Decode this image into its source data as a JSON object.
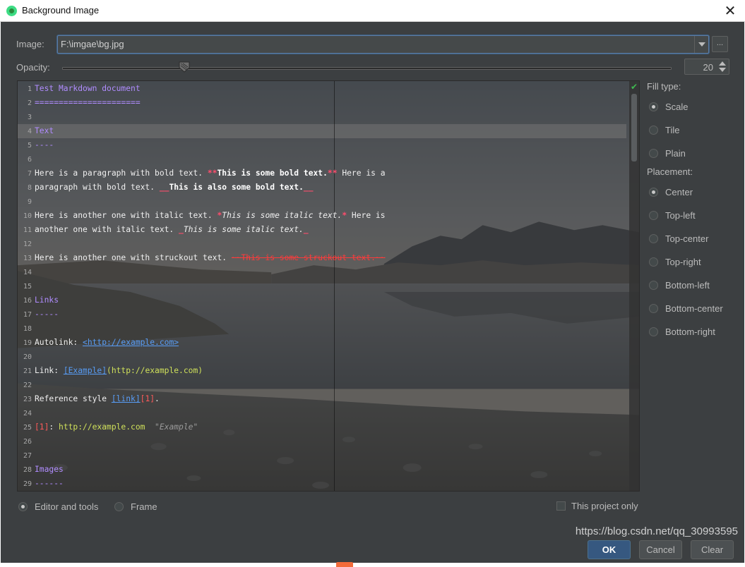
{
  "window": {
    "title": "Background Image",
    "close_glyph": "✕"
  },
  "image": {
    "label": "Image:",
    "value": "F:\\imgae\\bg.jpg",
    "browse_label": "..."
  },
  "opacity": {
    "label": "Opacity:",
    "value": "20",
    "level_percent": 20
  },
  "editor_lines": [
    {
      "n": "1",
      "tokens": [
        {
          "t": "Test Markdown document",
          "c": "t-head"
        }
      ]
    },
    {
      "n": "2",
      "tokens": [
        {
          "t": "======================",
          "c": "t-head"
        }
      ]
    },
    {
      "n": "3",
      "tokens": []
    },
    {
      "n": "4",
      "tokens": [
        {
          "t": "Text",
          "c": "t-head"
        }
      ]
    },
    {
      "n": "5",
      "tokens": [
        {
          "t": "----",
          "c": "t-head"
        }
      ]
    },
    {
      "n": "6",
      "tokens": []
    },
    {
      "n": "7",
      "tokens": [
        {
          "t": "Here is a paragraph with bold text. ",
          "c": "t-plain"
        },
        {
          "t": "**",
          "c": "t-mark"
        },
        {
          "t": "This is some bold text.",
          "c": "t-bold"
        },
        {
          "t": "**",
          "c": "t-mark"
        },
        {
          "t": " Here is a",
          "c": "t-plain"
        }
      ]
    },
    {
      "n": "8",
      "tokens": [
        {
          "t": "paragraph with bold text. ",
          "c": "t-plain"
        },
        {
          "t": "__",
          "c": "t-mark"
        },
        {
          "t": "This is also some bold text.",
          "c": "t-bold"
        },
        {
          "t": "__",
          "c": "t-mark"
        }
      ]
    },
    {
      "n": "9",
      "tokens": []
    },
    {
      "n": "10",
      "tokens": [
        {
          "t": "Here is another one with italic text. ",
          "c": "t-plain"
        },
        {
          "t": "*",
          "c": "t-mark"
        },
        {
          "t": "This is some italic text.",
          "c": "t-ital"
        },
        {
          "t": "*",
          "c": "t-mark"
        },
        {
          "t": " Here is",
          "c": "t-plain"
        }
      ]
    },
    {
      "n": "11",
      "tokens": [
        {
          "t": "another one with italic text. ",
          "c": "t-plain"
        },
        {
          "t": "_",
          "c": "t-mark"
        },
        {
          "t": "This is some italic text.",
          "c": "t-ital"
        },
        {
          "t": "_",
          "c": "t-mark"
        }
      ]
    },
    {
      "n": "12",
      "tokens": []
    },
    {
      "n": "13",
      "tokens": [
        {
          "t": "Here is another one with struckout text. ",
          "c": "t-plain"
        },
        {
          "t": "~~This is some struckout text.~~",
          "c": "t-strike"
        }
      ]
    },
    {
      "n": "14",
      "tokens": []
    },
    {
      "n": "15",
      "tokens": []
    },
    {
      "n": "16",
      "tokens": [
        {
          "t": "Links",
          "c": "t-head"
        }
      ]
    },
    {
      "n": "17",
      "tokens": [
        {
          "t": "-----",
          "c": "t-head"
        }
      ]
    },
    {
      "n": "18",
      "tokens": []
    },
    {
      "n": "19",
      "tokens": [
        {
          "t": "Autolink: ",
          "c": "t-plain"
        },
        {
          "t": "<http://example.com>",
          "c": "t-link"
        }
      ]
    },
    {
      "n": "20",
      "tokens": []
    },
    {
      "n": "21",
      "tokens": [
        {
          "t": "Link: ",
          "c": "t-plain"
        },
        {
          "t": "[Example]",
          "c": "t-link"
        },
        {
          "t": "(http://example.com)",
          "c": "t-url"
        }
      ]
    },
    {
      "n": "22",
      "tokens": []
    },
    {
      "n": "23",
      "tokens": [
        {
          "t": "Reference style ",
          "c": "t-plain"
        },
        {
          "t": "[link]",
          "c": "t-link"
        },
        {
          "t": "[1]",
          "c": "t-ref"
        },
        {
          "t": ".",
          "c": "t-plain"
        }
      ]
    },
    {
      "n": "24",
      "tokens": []
    },
    {
      "n": "25",
      "tokens": [
        {
          "t": "[1]",
          "c": "t-ref"
        },
        {
          "t": ": ",
          "c": "t-plain"
        },
        {
          "t": "http://example.com",
          "c": "t-url"
        },
        {
          "t": "  \"Example\"",
          "c": "t-title"
        }
      ]
    },
    {
      "n": "26",
      "tokens": []
    },
    {
      "n": "27",
      "tokens": []
    },
    {
      "n": "28",
      "tokens": [
        {
          "t": "Images",
          "c": "t-head"
        }
      ]
    },
    {
      "n": "29",
      "tokens": [
        {
          "t": "------",
          "c": "t-head"
        }
      ]
    }
  ],
  "fill_type": {
    "label": "Fill type:",
    "options": [
      {
        "label": "Scale",
        "selected": true
      },
      {
        "label": "Tile",
        "selected": false
      },
      {
        "label": "Plain",
        "selected": false
      }
    ]
  },
  "placement": {
    "label": "Placement:",
    "options": [
      {
        "label": "Center",
        "selected": true
      },
      {
        "label": "Top-left",
        "selected": false
      },
      {
        "label": "Top-center",
        "selected": false
      },
      {
        "label": "Top-right",
        "selected": false
      },
      {
        "label": "Bottom-left",
        "selected": false
      },
      {
        "label": "Bottom-center",
        "selected": false
      },
      {
        "label": "Bottom-right",
        "selected": false
      }
    ]
  },
  "target": {
    "editor_label": "Editor and tools",
    "frame_label": "Frame",
    "editor_selected": true
  },
  "project_only": {
    "label": "This project only",
    "checked": false
  },
  "buttons": {
    "ok": "OK",
    "cancel": "Cancel",
    "clear": "Clear"
  },
  "watermark": "https://blog.csdn.net/qq_30993595",
  "colors": {
    "background": "#3c3f41",
    "accent": "#365880",
    "heading": "#b08cff",
    "markup": "#ff4d6d"
  }
}
